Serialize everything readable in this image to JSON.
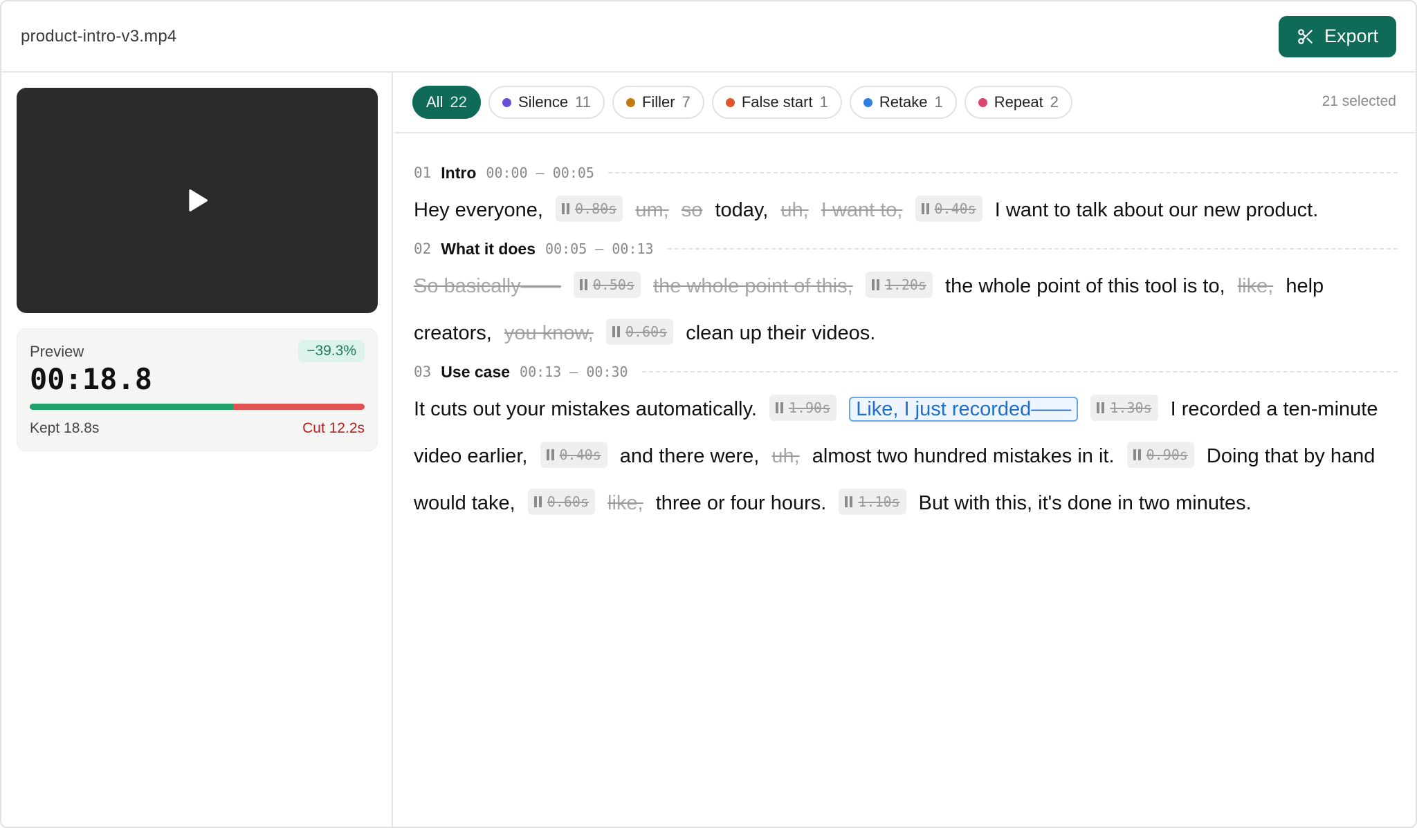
{
  "header": {
    "file_name": "product-intro-v3.mp4",
    "export_label": "Export"
  },
  "preview": {
    "label": "Preview",
    "time": "00:18.8",
    "reduction": "−39.3%",
    "kept_label": "Kept 18.8s",
    "cut_label": "Cut 12.2s",
    "kept_fraction": 0.607
  },
  "filters": {
    "chips": [
      {
        "label": "All",
        "count": "22",
        "active": true
      },
      {
        "label": "Silence",
        "count": "11",
        "color": "#6a4fd6"
      },
      {
        "label": "Filler",
        "count": "7",
        "color": "#c27a12"
      },
      {
        "label": "False start",
        "count": "1",
        "color": "#e0562a"
      },
      {
        "label": "Retake",
        "count": "1",
        "color": "#2f7fe0"
      },
      {
        "label": "Repeat",
        "count": "2",
        "color": "#d9466f"
      }
    ],
    "selected": "21 selected"
  },
  "sections": [
    {
      "num": "01",
      "title": "Intro",
      "range": "00:00 — 00:05",
      "tokens": [
        {
          "t": "Hey everyone,",
          "k": "w"
        },
        {
          "t": "0.80s",
          "k": "sil"
        },
        {
          "t": "um,",
          "k": "cut"
        },
        {
          "t": "so",
          "k": "cut"
        },
        {
          "t": "today,",
          "k": "w"
        },
        {
          "t": "uh,",
          "k": "cut"
        },
        {
          "t": "I want to,",
          "k": "cut"
        },
        {
          "t": "0.40s",
          "k": "sil"
        },
        {
          "t": "I want to talk about our new product.",
          "k": "w"
        }
      ]
    },
    {
      "num": "02",
      "title": "What it does",
      "range": "00:05 — 00:13",
      "tokens": [
        {
          "t": "So basically——",
          "k": "cut"
        },
        {
          "t": "0.50s",
          "k": "sil"
        },
        {
          "t": "the whole point of this,",
          "k": "cut"
        },
        {
          "t": "1.20s",
          "k": "sil"
        },
        {
          "t": "the whole point of this tool is to,",
          "k": "w"
        },
        {
          "t": "like,",
          "k": "cut"
        },
        {
          "t": "help creators,",
          "k": "w"
        },
        {
          "t": "you know,",
          "k": "cut"
        },
        {
          "t": "0.60s",
          "k": "sil"
        },
        {
          "t": "clean up their videos.",
          "k": "w"
        }
      ]
    },
    {
      "num": "03",
      "title": "Use case",
      "range": "00:13 — 00:30",
      "tokens": [
        {
          "t": "It cuts out your mistakes automatically.",
          "k": "w"
        },
        {
          "t": "1.90s",
          "k": "sil"
        },
        {
          "t": "Like, I just recorded——",
          "k": "hl"
        },
        {
          "t": "1.30s",
          "k": "sil"
        },
        {
          "t": "I recorded a ten-minute video earlier,",
          "k": "w"
        },
        {
          "t": "0.40s",
          "k": "sil"
        },
        {
          "t": "and there were,",
          "k": "w"
        },
        {
          "t": "uh,",
          "k": "cut"
        },
        {
          "t": "almost two hundred mistakes in it.",
          "k": "w"
        },
        {
          "t": "0.90s",
          "k": "sil"
        },
        {
          "t": "Doing that by hand would take,",
          "k": "w"
        },
        {
          "t": "0.60s",
          "k": "sil"
        },
        {
          "t": "like,",
          "k": "cut"
        },
        {
          "t": "three or four hours.",
          "k": "w"
        },
        {
          "t": "1.10s",
          "k": "sil"
        },
        {
          "t": "But with this, it's done in two minutes.",
          "k": "w"
        }
      ]
    }
  ]
}
